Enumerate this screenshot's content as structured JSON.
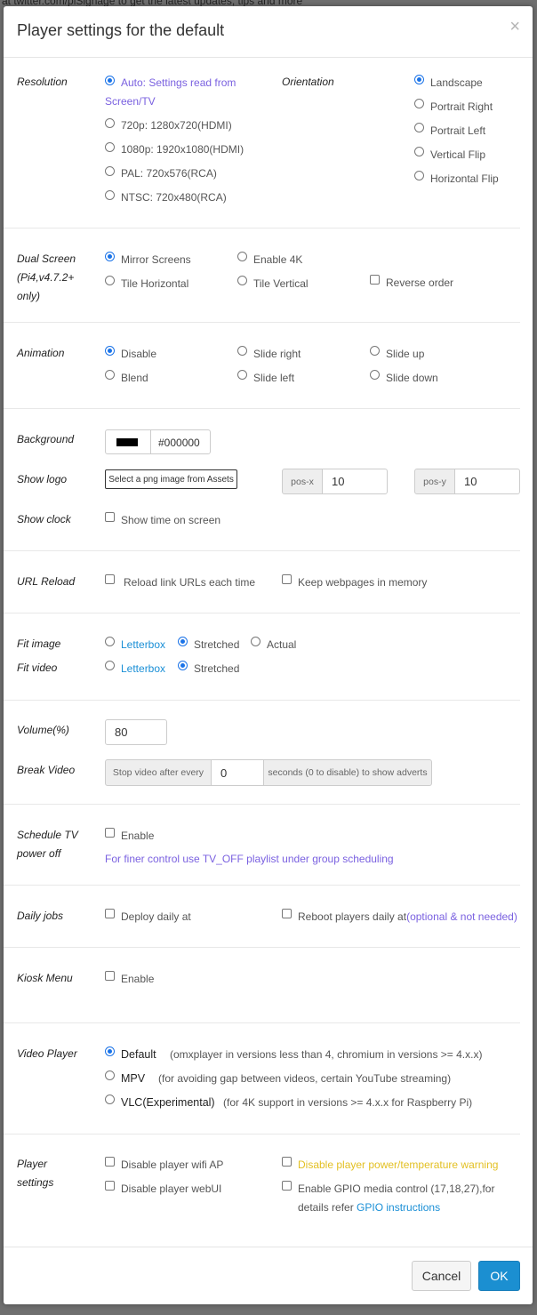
{
  "background_text": "at twitter.com/piSignage to get the latest updates, tips and more",
  "modal": {
    "title": "Player settings for the default",
    "close": "×"
  },
  "resolution": {
    "label": "Resolution",
    "options": [
      "Auto: Settings read from",
      "Screen/TV",
      "720p: 1280x720(HDMI)",
      "1080p: 1920x1080(HDMI)",
      "PAL: 720x576(RCA)",
      "NTSC: 720x480(RCA)"
    ]
  },
  "orientation": {
    "label": "Orientation",
    "options": [
      "Landscape",
      "Portrait Right",
      "Portrait Left",
      "Vertical Flip",
      "Horizontal Flip"
    ]
  },
  "dual_screen": {
    "label_lines": [
      "Dual Screen",
      "(Pi4,v4.7.2+",
      "only)"
    ],
    "options": [
      "Mirror Screens",
      "Enable 4K",
      "Tile Horizontal",
      "Tile Vertical"
    ],
    "reverse": "Reverse order"
  },
  "animation": {
    "label": "Animation",
    "options": [
      "Disable",
      "Slide right",
      "Slide up",
      "Blend",
      "Slide left",
      "Slide down"
    ]
  },
  "background": {
    "label": "Background",
    "value": "#000000",
    "swatch": "#000000"
  },
  "show_logo": {
    "label": "Show logo",
    "button": "Select a png image from Assets",
    "posx_label": "pos-x",
    "posx": "10",
    "posy_label": "pos-y",
    "posy": "10"
  },
  "show_clock": {
    "label": "Show clock",
    "option": "Show time on screen"
  },
  "url_reload": {
    "label": "URL Reload",
    "option1": "Reload link URLs each time",
    "option2": "Keep webpages in memory"
  },
  "fit_image": {
    "label": "Fit image",
    "options": [
      "Letterbox",
      "Stretched",
      "Actual"
    ]
  },
  "fit_video": {
    "label": "Fit video",
    "options": [
      "Letterbox",
      "Stretched"
    ]
  },
  "volume": {
    "label": "Volume(%)",
    "value": "80"
  },
  "break_video": {
    "label": "Break Video",
    "prefix": "Stop video after every",
    "value": "0",
    "suffix": "seconds (0 to disable) to show adverts"
  },
  "schedule_tv": {
    "label_lines": [
      "Schedule TV",
      "power off"
    ],
    "option": "Enable",
    "note": "For finer control use TV_OFF playlist under group scheduling"
  },
  "daily_jobs": {
    "label": "Daily jobs",
    "option1": "Deploy daily at",
    "option2": "Reboot players daily at",
    "option2_note": "(optional & not needed)"
  },
  "kiosk": {
    "label": "Kiosk Menu",
    "option": "Enable"
  },
  "video_player": {
    "label": "Video Player",
    "options": [
      {
        "name": "Default",
        "desc": "(omxplayer in versions less than 4, chromium in versions >= 4.x.x)"
      },
      {
        "name": "MPV",
        "desc": "(for avoiding gap between videos, certain YouTube streaming)"
      },
      {
        "name": "VLC(Experimental)",
        "desc": "(for 4K support in versions >= 4.x.x for Raspberry Pi)"
      }
    ]
  },
  "player_settings": {
    "label_lines": [
      "Player",
      "settings"
    ],
    "wifi": "Disable player wifi AP",
    "webui": "Disable player webUI",
    "power_warning": "Disable player power/temperature warning",
    "gpio_line1": "Enable GPIO media control (17,18,27),for",
    "gpio_line2": "details refer",
    "gpio_link": "GPIO instructions"
  },
  "footer": {
    "cancel": "Cancel",
    "ok": "OK"
  },
  "colors": {
    "accent": "#1a8fd6",
    "purple": "#7a61e0",
    "warning": "#e3c023",
    "ok_button": "#1b8fd1"
  }
}
